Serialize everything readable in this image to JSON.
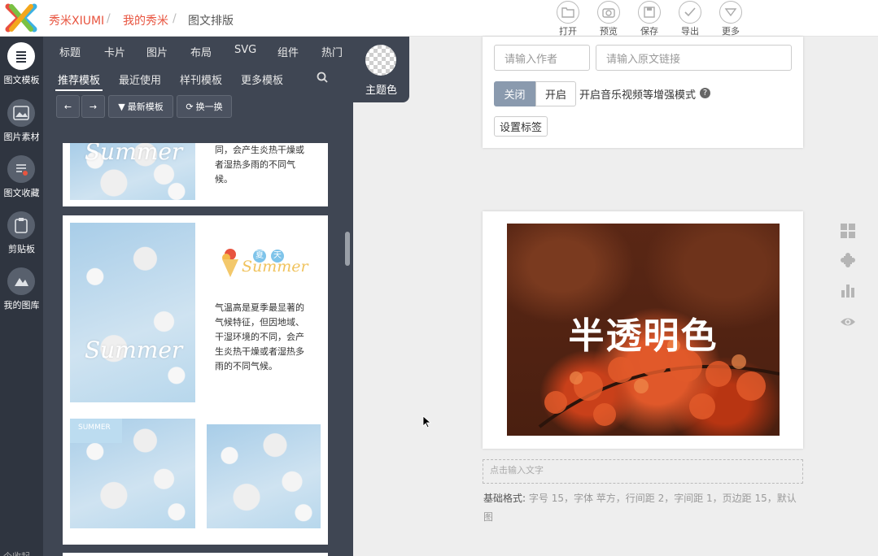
{
  "app": {
    "brand": "秀米XIUMI",
    "breadcrumb": [
      "我的秀米",
      "图文排版"
    ]
  },
  "toolbar": [
    {
      "label": "打开",
      "icon": "folder-icon"
    },
    {
      "label": "预览",
      "icon": "camera-icon"
    },
    {
      "label": "保存",
      "icon": "save-icon"
    },
    {
      "label": "导出",
      "icon": "check-icon"
    },
    {
      "label": "更多",
      "icon": "chevron-down-icon"
    }
  ],
  "rail": [
    {
      "label": "图文模板",
      "icon": "list-icon",
      "active": true
    },
    {
      "label": "图片素材",
      "icon": "image-icon"
    },
    {
      "label": "图文收藏",
      "icon": "bookmark-icon"
    },
    {
      "label": "剪贴板",
      "icon": "clipboard-icon"
    },
    {
      "label": "我的图库",
      "icon": "gallery-icon"
    }
  ],
  "rail_bottom": "个收起",
  "panel": {
    "tabs_top": [
      "标题",
      "卡片",
      "图片",
      "布局",
      "SVG",
      "组件",
      "热门"
    ],
    "tabs_sub": [
      "推荐模板",
      "最近使用",
      "样刊模板",
      "更多模板"
    ],
    "controls": {
      "prev": "←",
      "next": "→",
      "latest": "最新模板",
      "swap": "换一换"
    },
    "theme_label": "主题色"
  },
  "cards": {
    "card1_text": "同，会产生炎热干燥或者湿热多雨的不同气候。",
    "card2_badge": [
      "夏",
      "天"
    ],
    "card2_script": "Summer",
    "card2_text": "气温高是夏季最显著的气候特征，但因地域、干湿环境的不同，会产生炎热干燥或者湿热多雨的不同气候。",
    "photo_script": "Summer",
    "small_label": "SUMMER"
  },
  "editor": {
    "author_placeholder": "请输入作者",
    "link_placeholder": "请输入原文链接",
    "off": "关闭",
    "on": "开启",
    "enhance": "开启音乐视频等增强模式",
    "help": "?",
    "tag_button": "设置标签",
    "hero_text": "半透明色",
    "input_tip": "点击输入文字",
    "base_label": "基础格式:",
    "base_text": "字号 15，字体 苹方，行间距 2，字间距 1，页边距 15，默认图"
  },
  "right_tools": [
    "grid-icon",
    "puzzle-icon",
    "chart-icon",
    "eye-icon"
  ],
  "colors": {
    "brand": "#e8543f",
    "panel": "#3f4653",
    "rail": "#2f3540",
    "segment": "#8a9aae"
  }
}
